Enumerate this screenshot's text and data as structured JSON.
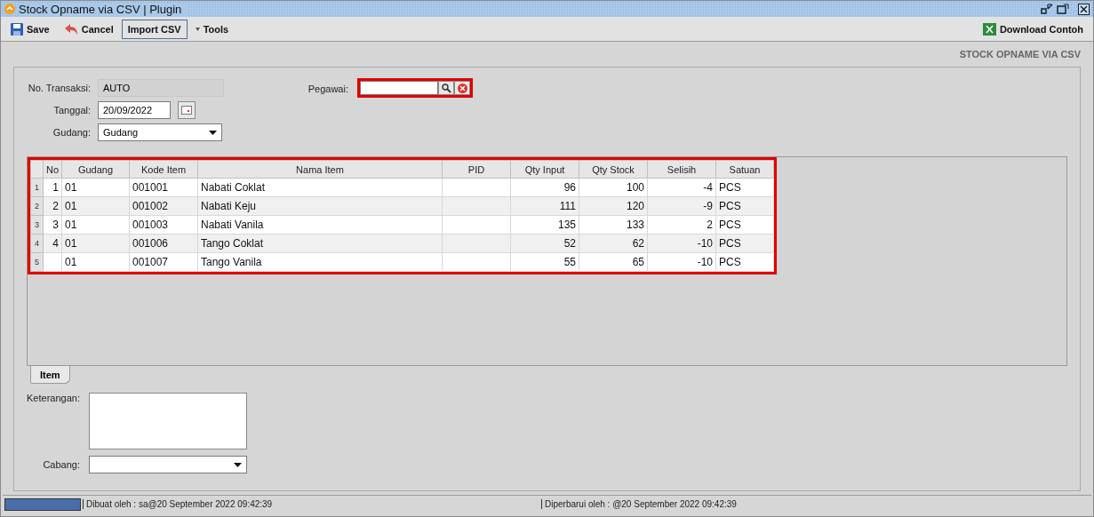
{
  "window": {
    "title": "Stock Opname via CSV | Plugin"
  },
  "toolbar": {
    "buttons": [
      {
        "label": "Save",
        "kind": "save"
      },
      {
        "label": "Cancel",
        "kind": "cancel"
      },
      {
        "label": "Import CSV",
        "kind": "plain",
        "selected": true
      },
      {
        "label": "Tools",
        "kind": "menu",
        "selected": false
      }
    ],
    "right_button": {
      "label": "Download Contoh"
    }
  },
  "form": {
    "heading": "STOCK OPNAME VIA CSV",
    "no_transaksi": {
      "label": "No. Transaksi:",
      "value": "AUTO"
    },
    "tanggal": {
      "label": "Tanggal:",
      "value": "20/09/2022"
    },
    "gudang": {
      "label": "Gudang:",
      "value": "Gudang"
    },
    "pegawai": {
      "label": "Pegawai:",
      "highlighted": true
    }
  },
  "table": {
    "highlighted": true,
    "columns": [
      {
        "label": "No"
      },
      {
        "label": "Gudang"
      },
      {
        "label": "Kode Item"
      },
      {
        "label": "Nama Item"
      },
      {
        "label": "PID"
      },
      {
        "label": "Qty Input"
      },
      {
        "label": "Qty Stock"
      },
      {
        "label": "Selisih"
      },
      {
        "label": "Satuan"
      }
    ],
    "rows": [
      {
        "index": "1",
        "cells": [
          "1",
          "01",
          "001001",
          "Nabati Coklat",
          "",
          "96",
          "100",
          "-4",
          "PCS"
        ]
      },
      {
        "index": "2",
        "cells": [
          "2",
          "01",
          "001002",
          "Nabati Keju",
          "",
          "111",
          "120",
          "-9",
          "PCS"
        ]
      },
      {
        "index": "3",
        "cells": [
          "3",
          "01",
          "001003",
          "Nabati Vanila",
          "",
          "135",
          "133",
          "2",
          "PCS"
        ]
      },
      {
        "index": "4",
        "cells": [
          "4",
          "01",
          "001006",
          "Tango Coklat",
          "",
          "52",
          "62",
          "-10",
          "PCS"
        ]
      },
      {
        "index": "5",
        "cells": [
          "",
          "01",
          "001007",
          "Tango Vanila",
          "",
          "55",
          "65",
          "-10",
          "PCS"
        ]
      }
    ]
  },
  "tabs": [
    {
      "label": "Item",
      "selected": true
    }
  ],
  "keterangan": {
    "label": "Keterangan:"
  },
  "cabang": {
    "label": "Cabang:"
  },
  "status_bar": {
    "created": "Dibuat oleh : sa@20 September 2022  09:42:39",
    "updated": "Diperbarui oleh : @20 September 2022  09:42:39"
  }
}
